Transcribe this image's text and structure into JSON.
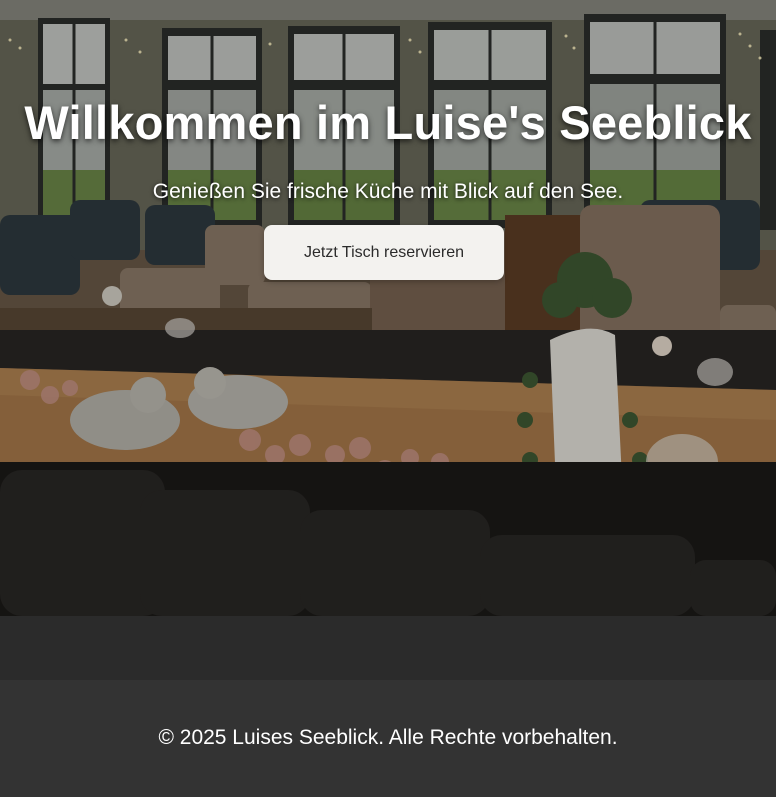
{
  "hero": {
    "image_alt": "Restaurant-Innenraum mit Seeblick",
    "title": "Willkommen im Luise's Seeblick",
    "subtitle": "Genießen Sie frische Küche mit Blick auf den See.",
    "cta_label": "Jetzt Tisch reservieren"
  },
  "footer": {
    "copyright": "© 2025 Luises Seeblick. Alle Rechte vorbehalten."
  },
  "colors": {
    "cta_background": "#f3f2ef",
    "footer_background": "#333333",
    "page_background": "#2b2b2b",
    "text": "#ffffff"
  }
}
